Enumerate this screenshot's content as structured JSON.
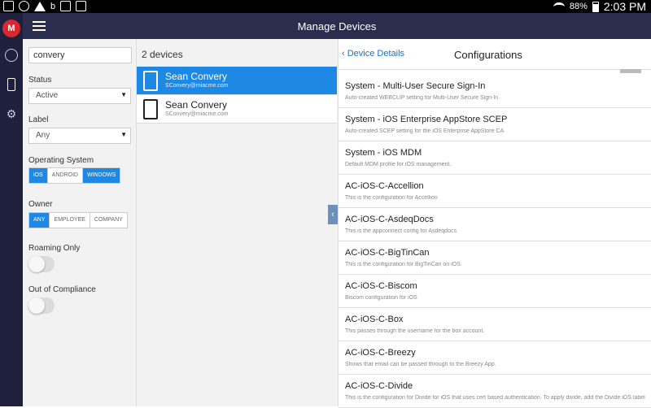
{
  "status_bar": {
    "battery": "88%",
    "time": "2:03 PM"
  },
  "app": {
    "logo_text": "M",
    "title": "Manage Devices"
  },
  "filters": {
    "search_value": "convery",
    "status": {
      "label": "Status",
      "selected": "Active"
    },
    "label": {
      "label": "Label",
      "selected": "Any"
    },
    "os": {
      "label": "Operating System",
      "options": [
        "iOS",
        "ANDROID",
        "WINDOWS"
      ],
      "selected": [
        "iOS",
        "WINDOWS"
      ]
    },
    "owner": {
      "label": "Owner",
      "options": [
        "ANY",
        "EMPLOYEE",
        "COMPANY"
      ],
      "selected": [
        "ANY"
      ]
    },
    "roaming": {
      "label": "Roaming Only",
      "value": false
    },
    "compliance": {
      "label": "Out of Compliance",
      "value": false
    }
  },
  "devices": {
    "count": "2 devices",
    "items": [
      {
        "name": "Sean Convery",
        "email": "SConvery@miacme.com",
        "selected": true
      },
      {
        "name": "Sean Convery",
        "email": "SConvery@miacme.com",
        "selected": false
      }
    ]
  },
  "configurations": {
    "back_label": "Device  Details",
    "title": "Configurations",
    "items": [
      {
        "name": "System - Multi-User Secure Sign-In",
        "desc": "Auto-created WEBCLIP setting for Multi-User Secure Sign-In"
      },
      {
        "name": "System - iOS Enterprise AppStore SCEP",
        "desc": "Auto-created SCEP setting for the iOS Enterprise AppStore CA"
      },
      {
        "name": "System - iOS MDM",
        "desc": "Default MDM profile for iOS management."
      },
      {
        "name": "AC-iOS-C-Accellion",
        "desc": "This is the configuration for Accellion"
      },
      {
        "name": "AC-iOS-C-AsdeqDocs",
        "desc": "This is the appconnect config for Asdeqdocs"
      },
      {
        "name": "AC-iOS-C-BigTinCan",
        "desc": "This is the configuration for BigTinCan on iOS."
      },
      {
        "name": "AC-iOS-C-Biscom",
        "desc": "Biscom configuration for iOS"
      },
      {
        "name": "AC-iOS-C-Box",
        "desc": "This passes through the username for the box account."
      },
      {
        "name": "AC-iOS-C-Breezy",
        "desc": "Shows that email can be passed through to the Breezy App."
      },
      {
        "name": "AC-iOS-C-Divide",
        "desc": "This is the configuration for Divide for iOS that uses cert based authentication. To apply divide, add the Divide iOS label"
      }
    ]
  }
}
